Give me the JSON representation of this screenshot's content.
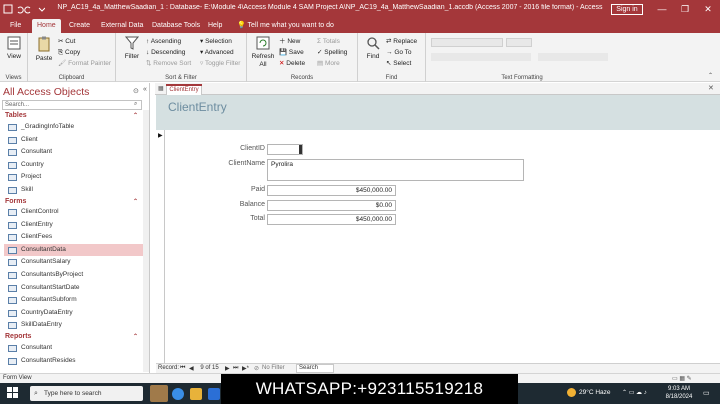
{
  "titlebar": {
    "title": "NP_AC19_4a_MatthewSaadian_1 : Database- E:\\Module 4\\Access Module 4 SAM Project A\\NP_AC19_4a_MatthewSaadian_1.accdb (Access 2007 - 2016 file format) - Access",
    "sign_in": "Sign in",
    "minimize": "—",
    "restore": "❐",
    "close": "✕"
  },
  "tabs": [
    "File",
    "Home",
    "Create",
    "External Data",
    "Database Tools",
    "Help"
  ],
  "tell_me": "Tell me what you want to do",
  "ribbon": {
    "views": {
      "label": "Views",
      "view": "View"
    },
    "clipboard": {
      "label": "Clipboard",
      "paste": "Paste",
      "cut": "Cut",
      "copy": "Copy",
      "format_painter": "Format Painter"
    },
    "sort_filter": {
      "label": "Sort & Filter",
      "filter": "Filter",
      "ascending": "Ascending",
      "descending": "Descending",
      "remove_sort": "Remove Sort",
      "selection": "Selection",
      "advanced": "Advanced",
      "toggle_filter": "Toggle Filter"
    },
    "records": {
      "label": "Records",
      "refresh_all": "Refresh All",
      "new": "New",
      "save": "Save",
      "delete": "Delete",
      "totals": "Totals",
      "spelling": "Spelling",
      "more": "More"
    },
    "find": {
      "label": "Find",
      "find": "Find",
      "replace": "Replace",
      "go_to": "Go To",
      "select": "Select"
    },
    "text_formatting": {
      "label": "Text Formatting"
    }
  },
  "nav": {
    "title": "All Access Objects",
    "search_placeholder": "Search...",
    "sections": [
      {
        "name": "Tables",
        "items": [
          "_GradingInfoTable",
          "Client",
          "Consultant",
          "Country",
          "Project",
          "Skill"
        ]
      },
      {
        "name": "Forms",
        "items": [
          "ClientControl",
          "ClientEntry",
          "ClientFees",
          "ConsultantData",
          "ConsultantSalary",
          "ConsultantsByProject",
          "ConsultantStartDate",
          "ConsultantSubform",
          "CountryDataEntry",
          "SkillDataEntry"
        ]
      },
      {
        "name": "Reports",
        "items": [
          "Consultant",
          "ConsultantResides"
        ]
      }
    ],
    "selected": "ConsultantData"
  },
  "document": {
    "tab": "ClientEntry",
    "form_title": "ClientEntry",
    "fields": [
      {
        "label": "ClientID",
        "value": ""
      },
      {
        "label": "ClientName",
        "value": "Pyrolira"
      },
      {
        "label": "Paid",
        "value": "$450,000.00"
      },
      {
        "label": "Balance",
        "value": "$0.00"
      },
      {
        "label": "Total",
        "value": "$450,000.00"
      }
    ]
  },
  "record_nav": {
    "label": "Record:",
    "position": "9 of 15",
    "filter": "No Filter",
    "search": "Search"
  },
  "status": "Form View",
  "taskbar": {
    "search_placeholder": "Type here to search",
    "weather": "29°C Haze",
    "time": "9:03 AM",
    "date": "8/18/2024"
  },
  "overlay": "WHATSAPP:+923115519218",
  "colors": {
    "accent": "#a4373a",
    "form_header": "#d5e0e1",
    "selected_item": "#f2c8c9"
  }
}
